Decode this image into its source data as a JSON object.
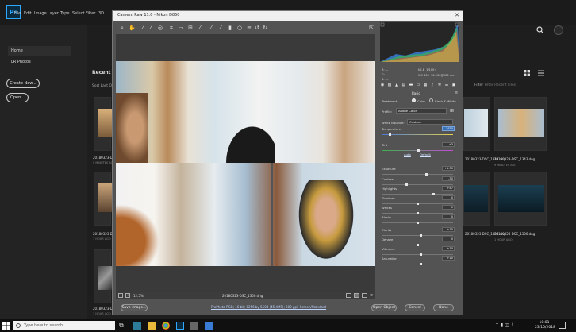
{
  "ps": {
    "logo": "Ps",
    "menu": [
      "File",
      "Edit",
      "Image",
      "Layer",
      "Type",
      "Select",
      "Filter",
      "3D",
      "View",
      "Window",
      "Help"
    ],
    "sidebar": {
      "home": "Home",
      "lr_photos": "LR Photos",
      "create_new": "Create New...",
      "open": "Open..."
    },
    "recent_title": "Recent",
    "sort_label": "Sort  Last O",
    "filter_label": "Filter",
    "filter_placeholder": "Filter Recent Files",
    "thumbnails": [
      {
        "name": "20180323-DSC_1343.dng",
        "sub": "9 MINUTES AGO"
      },
      {
        "name": "20180323-D",
        "sub": "9 MINUTES AGO"
      },
      {
        "name": "20180323-DSC_1343.dng",
        "sub": "9 MINUTES AGO"
      },
      {
        "name": "20180323-DSC_1306.dng",
        "sub": "1 HOUR AGO"
      },
      {
        "name": "20180323-D",
        "sub": "1 HOUR AGO"
      },
      {
        "name": "20180323-DSC_1306.dng",
        "sub": "1 HOUR AGO"
      },
      {
        "name": "20180323-D",
        "sub": "1 HOUR AGO"
      }
    ]
  },
  "camera_raw": {
    "title": "Camera Raw 11.0  -  Nikon D850",
    "info": {
      "fstop": "f/2.8",
      "shutter": "1/100 s",
      "iso": "ISO 800",
      "lens": "70-200@200 mm",
      "r": "R:",
      "g": "G:",
      "b": "B:",
      "dashes": "---"
    },
    "panel_title": "Basic",
    "treatment_label": "Treatment:",
    "treatment_color": "Color",
    "treatment_bw": "Black & White",
    "profile_label": "Profile:",
    "profile_value": "Adobe Color",
    "wb_label": "White Balance:",
    "wb_value": "Custom",
    "auto": "Auto",
    "default": "Default",
    "sliders": [
      {
        "label": "Temperature",
        "value": "3450",
        "pos": 0.12,
        "highlight": true
      },
      {
        "label": "Tint",
        "value": "+3",
        "pos": 0.52
      },
      {
        "label": "Exposure",
        "value": "+1.30",
        "pos": 0.63
      },
      {
        "label": "Contrast",
        "value": "-30",
        "pos": 0.35
      },
      {
        "label": "Highlights",
        "value": "+47",
        "pos": 0.73
      },
      {
        "label": "Shadows",
        "value": "0",
        "pos": 0.5
      },
      {
        "label": "Whites",
        "value": "0",
        "pos": 0.5
      },
      {
        "label": "Blacks",
        "value": "0",
        "pos": 0.5
      },
      {
        "label": "Clarity",
        "value": "+10",
        "pos": 0.55
      },
      {
        "label": "Dehaze",
        "value": "0",
        "pos": 0.5
      },
      {
        "label": "Vibrance",
        "value": "+10",
        "pos": 0.55
      },
      {
        "label": "Saturation",
        "value": "+10",
        "pos": 0.55
      }
    ],
    "zoom": "12.5%",
    "filename": "20180323-DSC_1350.dng",
    "workflow_link": "ProPhoto RGB; 16 bit; 8256 by 5504 (45.4MP); 300 ppi; Screen/Standard",
    "save_button": "Save Image...",
    "open_button": "Open Object",
    "cancel_button": "Cancel",
    "done_button": "Done"
  },
  "taskbar": {
    "search_placeholder": "Type here to search",
    "time": "10:01",
    "date": "23/10/2018"
  }
}
